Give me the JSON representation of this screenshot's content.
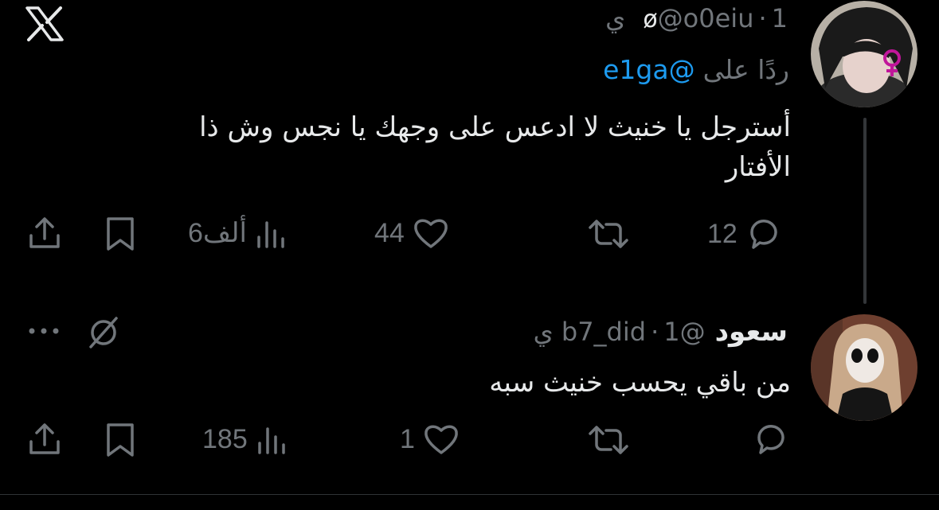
{
  "app": {
    "logo_icon": "x-logo-icon"
  },
  "thread": {
    "tweets": [
      {
        "display_name": "",
        "name_icon": "slashed-circle-icon",
        "handle": "@o0eiu",
        "separator": "·",
        "time": "1 ي",
        "replying_to_label": "ردًا على",
        "replying_to_handle": "@e1ga",
        "text_line1": "أسترجل يا خنيث لا ادعس على وجهك يا نجس وش ذا",
        "text_line2": "الأفتار",
        "stats": {
          "replies": "12",
          "reposts": "",
          "likes": "44",
          "views": "6ألف"
        }
      },
      {
        "display_name": "سعود",
        "handle": "@b7_did",
        "separator": "·",
        "time": "1 ي",
        "text_line1": "من باقي يحسب خنيث سبه",
        "stats": {
          "replies": "",
          "reposts": "",
          "likes": "1",
          "views": "185"
        }
      }
    ]
  },
  "colors": {
    "background": "#000000",
    "text": "#e7e9ea",
    "muted": "#71767b",
    "link": "#1d9bf0"
  }
}
